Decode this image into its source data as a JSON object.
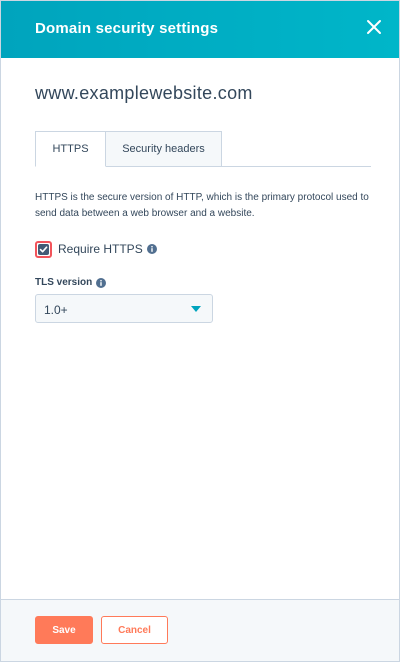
{
  "header": {
    "title": "Domain security settings"
  },
  "domain": "www.examplewebsite.com",
  "tabs": [
    {
      "label": "HTTPS",
      "active": true
    },
    {
      "label": "Security headers",
      "active": false
    }
  ],
  "description": "HTTPS is the secure version of HTTP, which is the primary protocol used to send data between a web browser and a website.",
  "require_https": {
    "label": "Require HTTPS",
    "checked": true
  },
  "tls": {
    "label": "TLS version",
    "selected": "1.0+"
  },
  "footer": {
    "save_label": "Save",
    "cancel_label": "Cancel"
  },
  "colors": {
    "header": "#00a4bd",
    "accent": "#ff7a59",
    "focus": "#f2545b",
    "text": "#33475b"
  },
  "icons": {
    "close": "close-icon",
    "info": "info-icon",
    "caret": "caret-down-icon",
    "check": "check-icon"
  }
}
